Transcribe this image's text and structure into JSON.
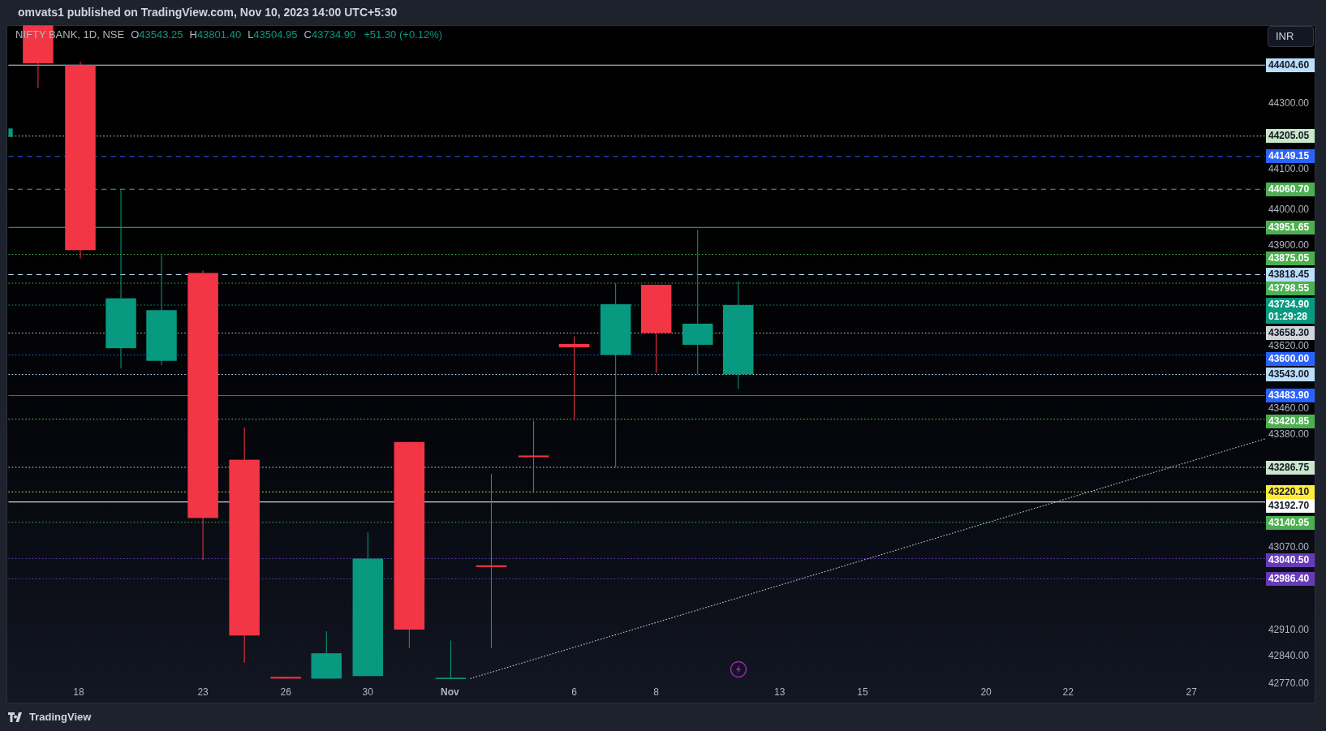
{
  "header": {
    "text": "omvats1 published on TradingView.com, Nov 10, 2023 14:00 UTC+5:30"
  },
  "legend": {
    "symbol": "NIFTY BANK, 1D, NSE",
    "values": [
      {
        "key": "O",
        "value": "43543.25"
      },
      {
        "key": "H",
        "value": "43801.40"
      },
      {
        "key": "L",
        "value": "43504.95"
      },
      {
        "key": "C",
        "value": "43734.90"
      }
    ],
    "change": "+51.30 (+0.12%)"
  },
  "currency_button": "INR",
  "price_axis": {
    "ticks": [
      "44300.00",
      "44100.00",
      "44000.00",
      "43900.00",
      "43620.00",
      "43460.00",
      "43380.00",
      "43070.00",
      "42910.00",
      "42840.00",
      "42770.00"
    ]
  },
  "levels": [
    {
      "price": "44404.60",
      "color": "#bbdefb",
      "kind": "solid"
    },
    {
      "price": "44205.05",
      "color": "#c8e6c9",
      "kind": "dotted"
    },
    {
      "price": "44149.15",
      "color": "#2962ff",
      "kind": "dashed"
    },
    {
      "price": "44060.70",
      "color": "#4caf50",
      "kind": "dashed"
    },
    {
      "price": "43951.65",
      "color": "#4caf50",
      "kind": "solid"
    },
    {
      "price": "43875.05",
      "color": "#4caf50",
      "kind": "dotted"
    },
    {
      "price": "43818.45",
      "color": "#bbdefb",
      "kind": "dashed"
    },
    {
      "price": "43798.55",
      "color": "#4caf50",
      "kind": "dotted"
    },
    {
      "price": "43734.90",
      "countdown": "01:29:28",
      "color": "#089981",
      "kind": "dotted"
    },
    {
      "price": "43658.30",
      "color": "#d1d4dc",
      "kind": "dotted"
    },
    {
      "price": "43600.00",
      "color": "#2962ff",
      "kind": "dotted"
    },
    {
      "price": "43543.00",
      "color": "#bbdefb",
      "kind": "dotted"
    },
    {
      "price": "43483.90",
      "color": "#2962ff",
      "kind": "solid"
    },
    {
      "price": "43420.85",
      "color": "#4caf50",
      "kind": "dotted"
    },
    {
      "price": "43286.75",
      "color": "#c8e6c9",
      "kind": "dotted"
    },
    {
      "price": "43220.10",
      "color": "#ffeb3b",
      "kind": "dotted"
    },
    {
      "price": "43192.70",
      "color": "#ffffff",
      "kind": "solid"
    },
    {
      "price": "43140.95",
      "color": "#4caf50",
      "kind": "dotted"
    },
    {
      "price": "43040.50",
      "color": "#673ab7",
      "kind": "dotted"
    },
    {
      "price": "42986.40",
      "color": "#673ab7",
      "kind": "dotted"
    }
  ],
  "time_axis": [
    {
      "label": "18",
      "kind": "day"
    },
    {
      "label": "23",
      "kind": "day"
    },
    {
      "label": "26",
      "kind": "day"
    },
    {
      "label": "30",
      "kind": "day"
    },
    {
      "label": "Nov",
      "kind": "month"
    },
    {
      "label": "6",
      "kind": "day"
    },
    {
      "label": "8",
      "kind": "day"
    },
    {
      "label": "13",
      "kind": "day"
    },
    {
      "label": "15",
      "kind": "day"
    },
    {
      "label": "20",
      "kind": "day"
    },
    {
      "label": "22",
      "kind": "day"
    },
    {
      "label": "27",
      "kind": "day"
    }
  ],
  "footer": {
    "brand": "TradingView"
  }
}
